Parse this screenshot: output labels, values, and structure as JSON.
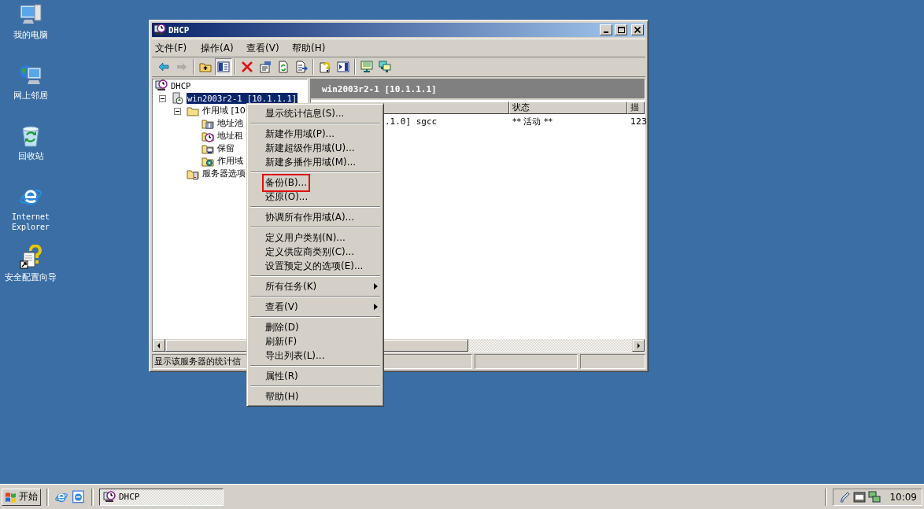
{
  "desktop_icons": [
    {
      "label": "我的电脑",
      "kind": "computer"
    },
    {
      "label": "网上邻居",
      "kind": "network"
    },
    {
      "label": "回收站",
      "kind": "recycle"
    },
    {
      "label": "Internet Explorer",
      "kind": "browser"
    },
    {
      "label": "安全配置向导",
      "kind": "wizard"
    }
  ],
  "window": {
    "title": "DHCP",
    "active": true
  },
  "menu_bar": [
    "文件(F)",
    "操作(A)",
    "查看(V)",
    "帮助(H)"
  ],
  "toolbar": [
    {
      "kind": "back",
      "disabled": false,
      "pressed": false
    },
    {
      "kind": "forward",
      "disabled": true,
      "pressed": false
    },
    {
      "kind": "separator"
    },
    {
      "kind": "up",
      "disabled": false,
      "pressed": false
    },
    {
      "kind": "tree",
      "disabled": false,
      "pressed": true
    },
    {
      "kind": "separator"
    },
    {
      "kind": "delete",
      "disabled": false,
      "pressed": false
    },
    {
      "kind": "properties",
      "disabled": false,
      "pressed": false
    },
    {
      "kind": "refresh",
      "disabled": false,
      "pressed": false
    },
    {
      "kind": "export",
      "disabled": false,
      "pressed": false
    },
    {
      "kind": "separator"
    },
    {
      "kind": "help",
      "disabled": false,
      "pressed": false
    },
    {
      "kind": "panel",
      "disabled": false,
      "pressed": false
    },
    {
      "kind": "separator"
    },
    {
      "kind": "monitor",
      "disabled": false,
      "pressed": false
    },
    {
      "kind": "monitors",
      "disabled": false,
      "pressed": false
    }
  ],
  "tree": [
    {
      "label": "DHCP",
      "kind": "dhcp",
      "selected": false,
      "children": [
        {
          "label": "win2003r2-1 [10.1.1.1]",
          "kind": "server",
          "selected": true,
          "expanded": true,
          "children": [
            {
              "label": "作用域 [10",
              "kind": "folder",
              "selected": false,
              "expanded": true,
              "children": [
                {
                  "label": "地址池",
                  "kind": "pool",
                  "selected": false
                },
                {
                  "label": "地址租",
                  "kind": "leases",
                  "selected": false
                },
                {
                  "label": "保留",
                  "kind": "reserve",
                  "selected": false
                },
                {
                  "label": "作用域",
                  "kind": "options",
                  "selected": false
                }
              ]
            },
            {
              "label": "服务器选项",
              "kind": "serveroptions",
              "selected": false
            }
          ]
        }
      ]
    }
  ],
  "details": {
    "title": "win2003r2-1 [10.1.1.1]",
    "columns": [
      "",
      "状态",
      "描"
    ],
    "rows": [
      {
        "cells": [
          ".1.0] sgcc",
          "** 活动 **",
          "123"
        ]
      }
    ]
  },
  "status_bar": [
    "显示该服务器的统计信"
  ],
  "context_menu": [
    [
      {
        "label": "显示统计信息(S)...",
        "submenu": false,
        "outlined": false
      }
    ],
    [
      {
        "label": "新建作用域(P)...",
        "submenu": false,
        "outlined": false
      },
      {
        "label": "新建超级作用域(U)...",
        "submenu": false,
        "outlined": false
      },
      {
        "label": "新建多播作用域(M)...",
        "submenu": false,
        "outlined": false
      }
    ],
    [
      {
        "label": "备份(B)...",
        "submenu": false,
        "outlined": true
      },
      {
        "label": "还原(O)...",
        "submenu": false,
        "outlined": false
      }
    ],
    [
      {
        "label": "协调所有作用域(A)...",
        "submenu": false,
        "outlined": false
      }
    ],
    [
      {
        "label": "定义用户类别(N)...",
        "submenu": false,
        "outlined": false
      },
      {
        "label": "定义供应商类别(C)...",
        "submenu": false,
        "outlined": false
      },
      {
        "label": "设置预定义的选项(E)...",
        "submenu": false,
        "outlined": false
      }
    ],
    [
      {
        "label": "所有任务(K)",
        "submenu": true,
        "outlined": false
      }
    ],
    [
      {
        "label": "查看(V)",
        "submenu": true,
        "outlined": false
      }
    ],
    [
      {
        "label": "删除(D)",
        "submenu": false,
        "outlined": false
      },
      {
        "label": "刷新(F)",
        "submenu": false,
        "outlined": false
      },
      {
        "label": "导出列表(L)...",
        "submenu": false,
        "outlined": false
      }
    ],
    [
      {
        "label": "属性(R)",
        "submenu": false,
        "outlined": false
      }
    ],
    [
      {
        "label": "帮助(H)",
        "submenu": false,
        "outlined": false
      }
    ]
  ],
  "taskbar": {
    "start": "开始",
    "tasks": [
      {
        "label": "DHCP",
        "selected": true
      }
    ],
    "clock": "10:09"
  }
}
